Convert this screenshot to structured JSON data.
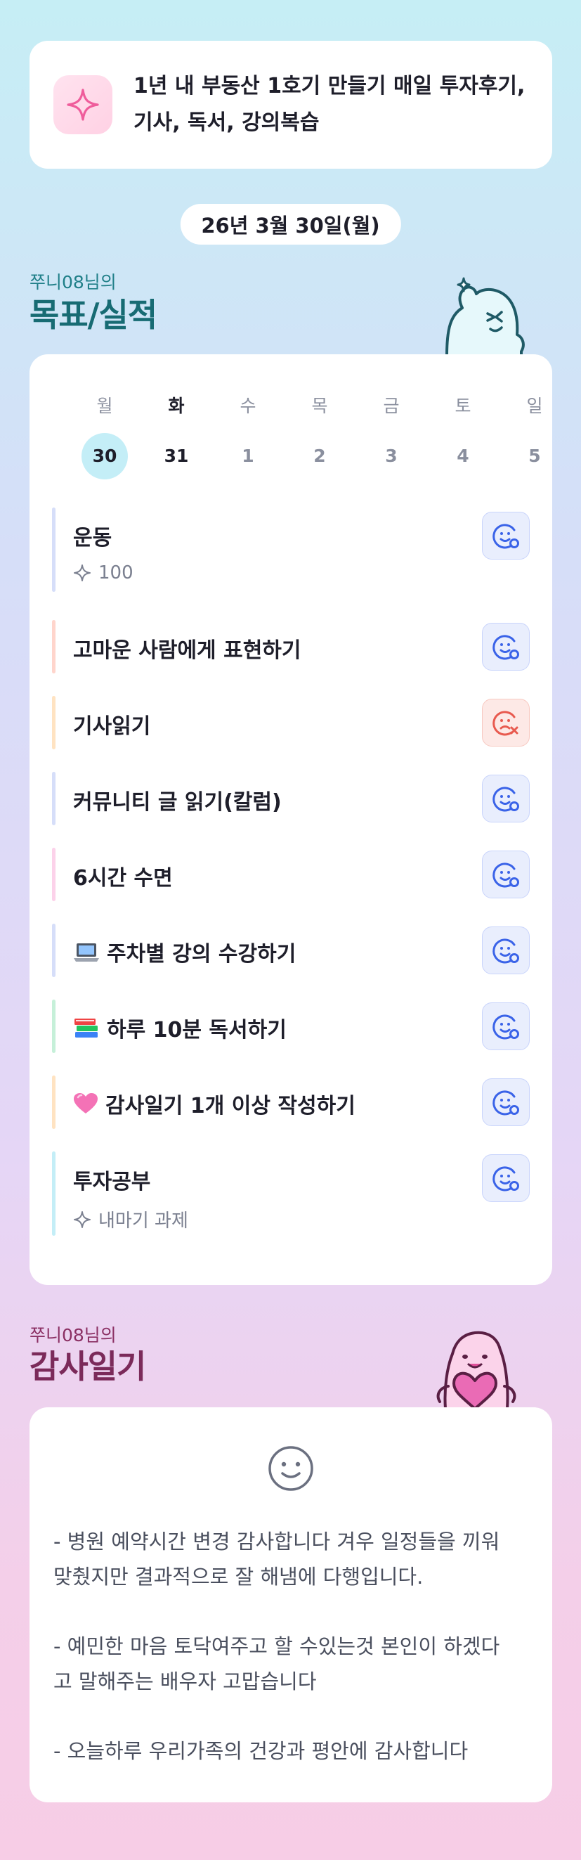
{
  "goal": {
    "icon": "sparkle-icon",
    "line1": "1년 내 부동산 1호기 만들기 매일 투자후기,",
    "line2": "기사, 독서, 강의복습"
  },
  "date_label": "26년 3월 30일(월)",
  "habits_section": {
    "owner": "쭈니08님의",
    "title": "목표/실적"
  },
  "week": {
    "days": [
      "월",
      "화",
      "수",
      "목",
      "금",
      "토",
      "일"
    ],
    "dates": [
      "30",
      "31",
      "1",
      "2",
      "3",
      "4",
      "5"
    ],
    "selected_index": 0
  },
  "habits": [
    {
      "title": "운동",
      "sub": "100",
      "color": "#d6def9",
      "status": "success"
    },
    {
      "title": "고마운 사람에게 표현하기",
      "sub": "",
      "color": "#ffd5cc",
      "status": "success"
    },
    {
      "title": "기사읽기",
      "sub": "",
      "color": "#ffe3c2",
      "status": "fail"
    },
    {
      "title": "커뮤니티 글 읽기(칼럼)",
      "sub": "",
      "color": "#d6def9",
      "status": "success"
    },
    {
      "title": "6시간 수면",
      "sub": "",
      "color": "#fcd2ea",
      "status": "success"
    },
    {
      "title": "주차별 강의 수강하기",
      "sub": "",
      "color": "#d6def9",
      "status": "success",
      "icon": "laptop-icon"
    },
    {
      "title": "하루 10분 독서하기",
      "sub": "",
      "color": "#c6f0d9",
      "status": "success",
      "icon": "books-icon"
    },
    {
      "title": "감사일기 1개 이상 작성하기",
      "sub": "",
      "color": "#ffe3c2",
      "status": "success",
      "icon": "pink-heart-icon"
    },
    {
      "title": "투자공부",
      "sub": "내마기 과제",
      "color": "#c4eef7",
      "status": "success"
    }
  ],
  "gratitude_section": {
    "owner": "쭈니08님의",
    "title": "감사일기"
  },
  "gratitude": {
    "p1_l1": "- 병원 예약시간 변경 감사합니다 겨우 일정들을 끼워",
    "p1_l2": "맞췄지만 결과적으로 잘 해냄에 다행입니다.",
    "p2_l1": "- 예민한 마음 토닥여주고 할 수있는것 본인이 하겠다",
    "p2_l2": "고 말해주는 배우자 고맙습니다",
    "p3_l1": "- 오늘하루 우리가족의 건강과 평안에 감사합니다"
  },
  "colors": {
    "teal_title": "#176b73",
    "plum_title": "#7b2a5a",
    "success_icon": "#3a63e8",
    "fail_icon": "#e85a4f"
  }
}
